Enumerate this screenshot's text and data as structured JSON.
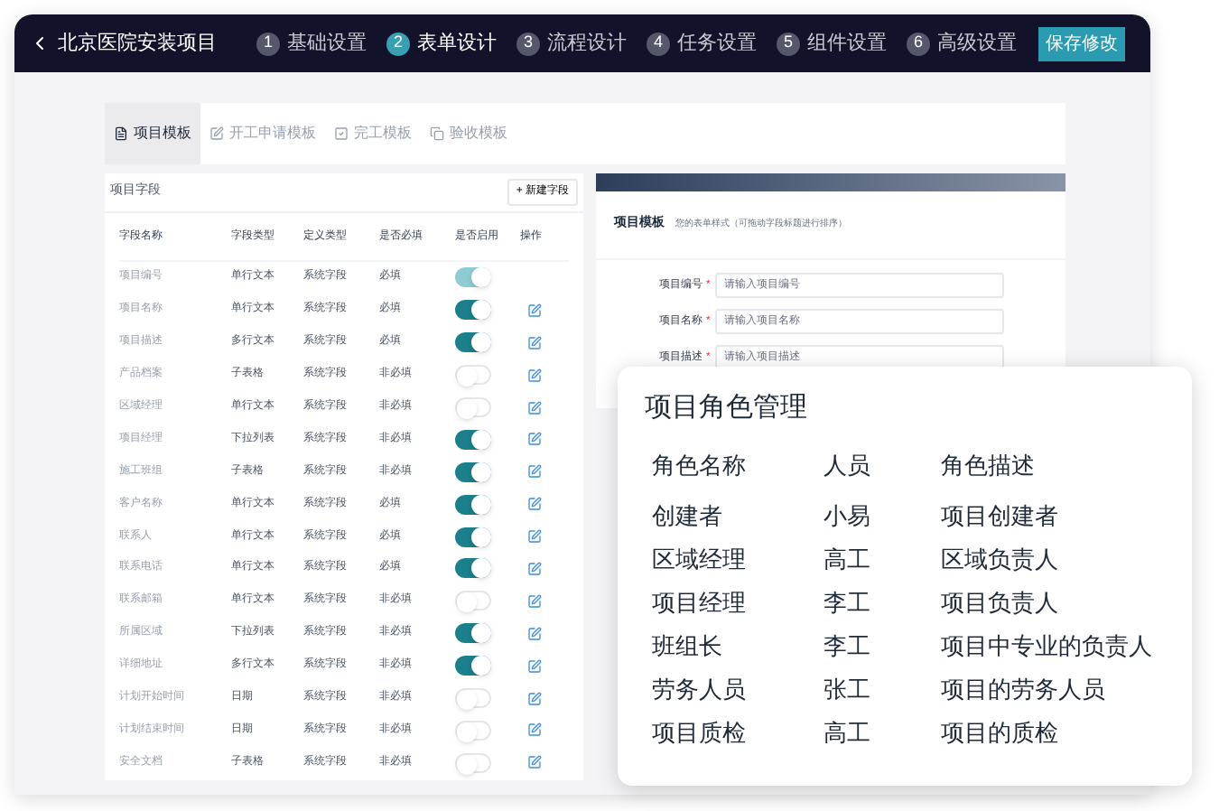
{
  "header": {
    "back": "北京医院安装项目",
    "steps": [
      {
        "number": "1",
        "label": "基础设置",
        "selected": false
      },
      {
        "number": "2",
        "label": "表单设计",
        "selected": true
      },
      {
        "number": "3",
        "label": "流程设计",
        "selected": false
      },
      {
        "number": "4",
        "label": "任务设置",
        "selected": false
      },
      {
        "number": "5",
        "label": "组件设置",
        "selected": false
      },
      {
        "number": "6",
        "label": "高级设置",
        "selected": false
      }
    ],
    "save": "保存修改"
  },
  "template_tabs": [
    {
      "label": "项目模板",
      "kind": "file",
      "selected": true
    },
    {
      "label": "开工申请模板",
      "kind": "edit",
      "selected": false
    },
    {
      "label": "完工模板",
      "kind": "check",
      "selected": false
    },
    {
      "label": "验收模板",
      "kind": "copy",
      "selected": false
    }
  ],
  "fields_panel": {
    "title": "项目字段",
    "add_button": "+ 新建字段",
    "columns": [
      "字段名称",
      "字段类型",
      "定义类型",
      "是否必填",
      "是否启用",
      "操作"
    ],
    "rows": [
      {
        "name": "项目编号",
        "type": "单行文本",
        "definition": "系统字段",
        "required": "必填",
        "on": true,
        "disabled": true,
        "editable": false
      },
      {
        "name": "项目名称",
        "type": "单行文本",
        "definition": "系统字段",
        "required": "必填",
        "on": true,
        "disabled": false,
        "editable": true
      },
      {
        "name": "项目描述",
        "type": "多行文本",
        "definition": "系统字段",
        "required": "必填",
        "on": true,
        "disabled": false,
        "editable": true
      },
      {
        "name": "产品档案",
        "type": "子表格",
        "definition": "系统字段",
        "required": "非必填",
        "on": false,
        "disabled": false,
        "editable": true
      },
      {
        "name": "区域经理",
        "type": "单行文本",
        "definition": "系统字段",
        "required": "非必填",
        "on": false,
        "disabled": false,
        "editable": true
      },
      {
        "name": "项目经理",
        "type": "下拉列表",
        "definition": "系统字段",
        "required": "非必填",
        "on": true,
        "disabled": false,
        "editable": true
      },
      {
        "name": "施工班组",
        "type": "子表格",
        "definition": "系统字段",
        "required": "非必填",
        "on": true,
        "disabled": false,
        "editable": true
      },
      {
        "name": "客户名称",
        "type": "单行文本",
        "definition": "系统字段",
        "required": "必填",
        "on": true,
        "disabled": false,
        "editable": true
      },
      {
        "name": "联系人",
        "type": "单行文本",
        "definition": "系统字段",
        "required": "必填",
        "on": true,
        "disabled": false,
        "editable": true
      },
      {
        "name": "联系电话",
        "type": "单行文本",
        "definition": "系统字段",
        "required": "必填",
        "on": true,
        "disabled": false,
        "editable": true
      },
      {
        "name": "联系邮箱",
        "type": "单行文本",
        "definition": "系统字段",
        "required": "非必填",
        "on": false,
        "disabled": false,
        "editable": true
      },
      {
        "name": "所属区域",
        "type": "下拉列表",
        "definition": "系统字段",
        "required": "非必填",
        "on": true,
        "disabled": false,
        "editable": true
      },
      {
        "name": "详细地址",
        "type": "多行文本",
        "definition": "系统字段",
        "required": "非必填",
        "on": true,
        "disabled": false,
        "editable": true
      },
      {
        "name": "计划开始时间",
        "type": "日期",
        "definition": "系统字段",
        "required": "非必填",
        "on": false,
        "disabled": false,
        "editable": true
      },
      {
        "name": "计划结束时间",
        "type": "日期",
        "definition": "系统字段",
        "required": "非必填",
        "on": false,
        "disabled": false,
        "editable": true
      },
      {
        "name": "安全文档",
        "type": "子表格",
        "definition": "系统字段",
        "required": "非必填",
        "on": false,
        "disabled": false,
        "editable": true
      }
    ]
  },
  "preview": {
    "title": "项目模板",
    "subtitle": "您的表单样式（可拖动字段标题进行排序）",
    "fields": [
      {
        "label": "项目编号",
        "required_mark": "*",
        "placeholder": "请输入项目编号"
      },
      {
        "label": "项目名称",
        "required_mark": "*",
        "placeholder": "请输入项目名称"
      },
      {
        "label": "项目描述",
        "required_mark": "*",
        "placeholder": "请输入项目描述"
      }
    ]
  },
  "roles_card": {
    "title": "项目角色管理",
    "columns": [
      "角色名称",
      "人员",
      "角色描述"
    ],
    "rows": [
      [
        "创建者",
        "小易",
        "项目创建者"
      ],
      [
        "区域经理",
        "高工",
        "区域负责人"
      ],
      [
        "项目经理",
        "李工",
        "项目负责人"
      ],
      [
        "班组长",
        "李工",
        "项目中专业的负责人"
      ],
      [
        "劳务人员",
        "张工",
        "项目的劳务人员"
      ],
      [
        "项目质检",
        "高工",
        "项目的质检"
      ]
    ]
  }
}
